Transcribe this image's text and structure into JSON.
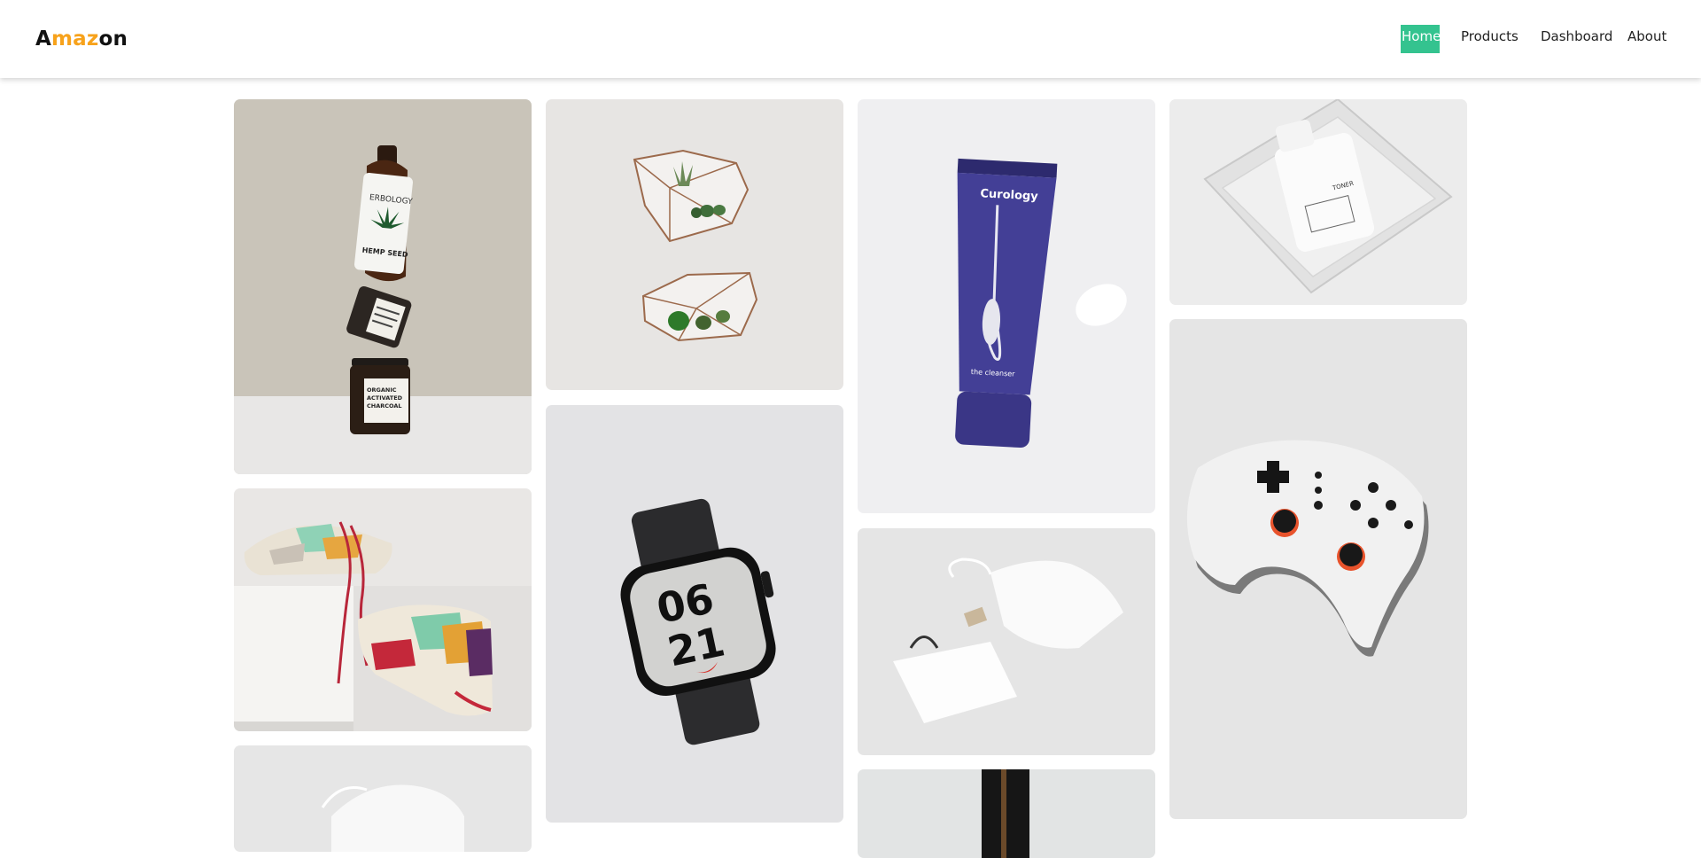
{
  "logo": {
    "first_letter": "A",
    "middle": "maz",
    "rest": "on"
  },
  "nav": {
    "items": [
      "Home",
      "Products",
      "Dashboard",
      "About"
    ],
    "active": "Home"
  },
  "colors": {
    "accent": "#34c38f",
    "logo_orange": "#f7a21b"
  },
  "products": [
    {
      "name": "hemp-seed-bottle-stack",
      "labels": {
        "bottle": "HEMP SEED",
        "brand": "ERBOLOGY",
        "jar": "ORGANIC ACTIVATED CHARCOAL"
      }
    },
    {
      "name": "geometric-terrarium-planters"
    },
    {
      "name": "curology-cleanser-tube",
      "labels": {
        "brand": "Curology",
        "subtitle": "the cleanser"
      }
    },
    {
      "name": "toner-bottle-in-pouch",
      "labels": {
        "type": "TONER"
      }
    },
    {
      "name": "sneakers-on-box"
    },
    {
      "name": "smartwatch",
      "labels": {
        "hour": "06",
        "minute": "21"
      }
    },
    {
      "name": "drawstring-pouch-and-bag"
    },
    {
      "name": "game-controller"
    },
    {
      "name": "drawstring-pouch-partial"
    },
    {
      "name": "dark-product-partial"
    }
  ]
}
